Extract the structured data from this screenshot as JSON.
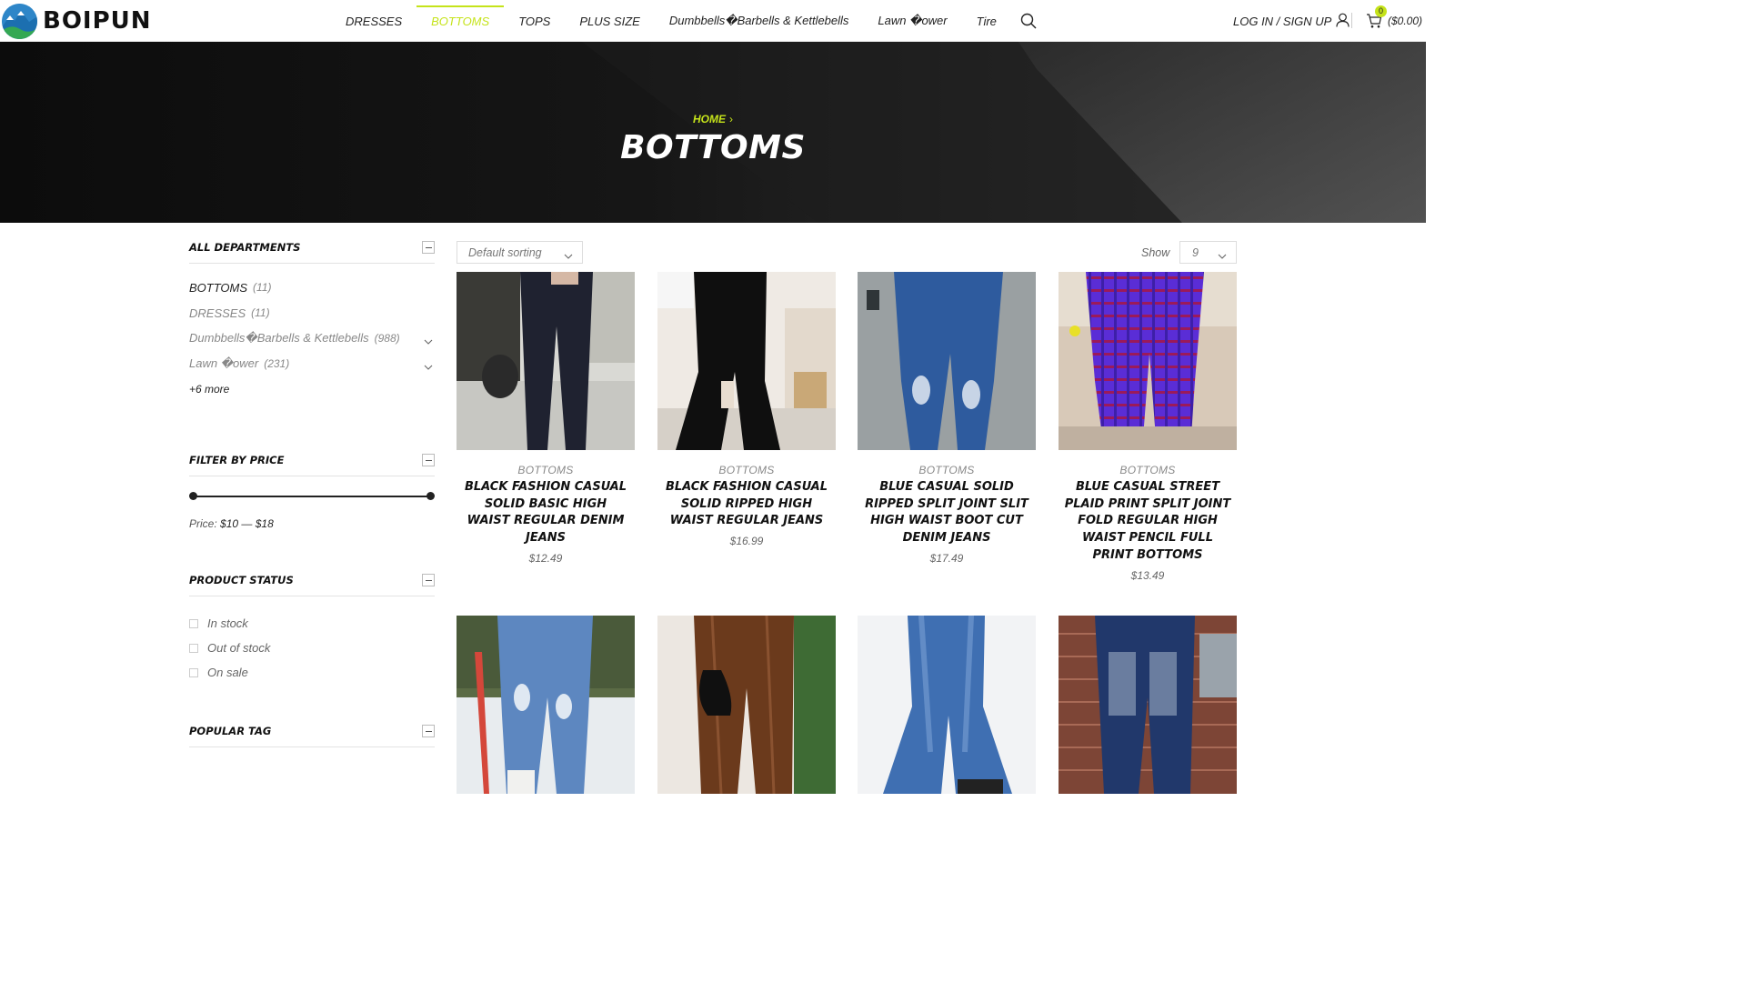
{
  "brand": {
    "name": "BOIPUN",
    "logo_icon": "mountain-globe-icon"
  },
  "nav": {
    "items": [
      {
        "label": "DRESSES",
        "active": false
      },
      {
        "label": "BOTTOMS",
        "active": true
      },
      {
        "label": "TOPS",
        "active": false
      },
      {
        "label": "PLUS SIZE",
        "active": false
      },
      {
        "label": "Dumbbells�Barbells & Kettlebells",
        "active": false
      },
      {
        "label": "Lawn �ower",
        "active": false
      },
      {
        "label": "Tire",
        "active": false
      }
    ],
    "search_icon": "search-icon"
  },
  "account": {
    "label": "LOG IN / SIGN UP",
    "icon": "user-icon"
  },
  "cart": {
    "count": "0",
    "total": "($0.00)",
    "icon": "cart-icon"
  },
  "hero": {
    "breadcrumb_home": "HOME",
    "title": "BOTTOMS"
  },
  "sidebar": {
    "departments": {
      "title": "ALL DEPARTMENTS",
      "items": [
        {
          "label": "BOTTOMS",
          "count": "(11)"
        },
        {
          "label": "DRESSES",
          "count": "(11)"
        },
        {
          "label": "Dumbbells�Barbells & Kettlebells",
          "count": "(988)"
        },
        {
          "label": "Lawn �ower",
          "count": "(231)"
        }
      ],
      "more": "+6 more"
    },
    "price": {
      "title": "FILTER BY PRICE",
      "prefix": "Price:",
      "min": "$10",
      "dash": "—",
      "max": "$18",
      "range_fraction": [
        0,
        1
      ]
    },
    "status": {
      "title": "PRODUCT STATUS",
      "options": [
        "In stock",
        "Out of stock",
        "On sale"
      ]
    },
    "tags": {
      "title": "POPULAR TAG"
    }
  },
  "toolbar": {
    "sort": "Default sorting",
    "show_label": "Show",
    "show_value": "9"
  },
  "products": [
    {
      "category": "BOTTOMS",
      "title": "BLACK FASHION CASUAL SOLID BASIC HIGH WAIST REGULAR DENIM JEANS",
      "price": "$12.49"
    },
    {
      "category": "BOTTOMS",
      "title": "BLACK FASHION CASUAL SOLID RIPPED HIGH WAIST REGULAR JEANS",
      "price": "$16.99"
    },
    {
      "category": "BOTTOMS",
      "title": "BLUE CASUAL SOLID RIPPED SPLIT JOINT SLIT HIGH WAIST BOOT CUT DENIM JEANS",
      "price": "$17.49"
    },
    {
      "category": "BOTTOMS",
      "title": "BLUE CASUAL STREET PLAID PRINT SPLIT JOINT FOLD REGULAR HIGH WAIST PENCIL FULL PRINT BOTTOMS",
      "price": "$13.49"
    }
  ],
  "colors": {
    "accent": "#c5e31a",
    "hero_bg": "#101010"
  }
}
